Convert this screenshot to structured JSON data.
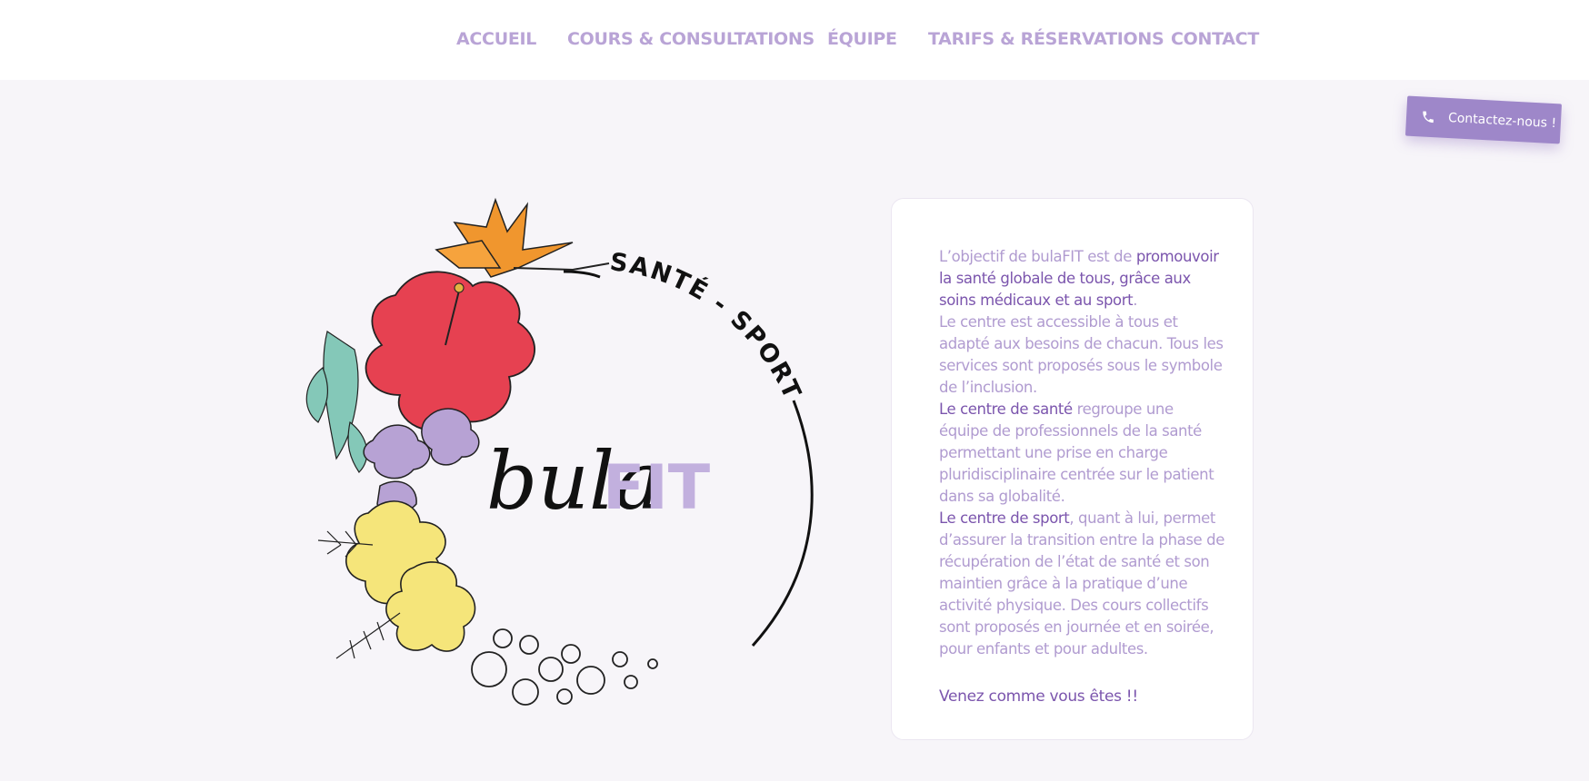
{
  "nav": {
    "items": [
      {
        "label": "ACCUEIL"
      },
      {
        "label": "COURS & CONSULTATIONS"
      },
      {
        "label": "ÉQUIPE"
      },
      {
        "label": "TARIFS & RÉSERVATIONS"
      },
      {
        "label": "CONTACT"
      }
    ]
  },
  "contact_button": {
    "label": "Contactez-nous !",
    "icon": "phone-icon"
  },
  "logo": {
    "arc_text": "SANTÉ - SPORT",
    "name_part1": "bula",
    "name_part2": "FIT"
  },
  "card": {
    "p1_prefix": "L’objectif de bulaFIT est de ",
    "p1_strong": "promouvoir la santé globale de tous, grâce aux soins médicaux et au sport",
    "p1_suffix": ".",
    "p2": "Le centre est accessible à tous et adapté aux besoins de chacun. Tous les services sont proposés sous le symbole de l’inclusion.",
    "p3_strong": "Le centre de santé",
    "p3_rest": " regroupe une équipe de professionnels de la santé permettant une prise en charge pluridisciplinaire centrée sur le patient dans sa globalité.",
    "p4_strong": "Le centre de sport",
    "p4_rest": ", quant à lui, permet d’assurer la transition entre la phase de récupération de l’état de santé et son maintien grâce à la pratique d’une activité physique. Des cours collectifs sont proposés en journée et en soirée, pour enfants et pour adultes.",
    "closing": "Venez comme vous êtes !!"
  },
  "colors": {
    "accent": "#9e87c9",
    "nav": "#b9a4d6",
    "strong_text": "#7b55ad",
    "body_text": "#b09bd0",
    "background": "#f7f5f9"
  }
}
